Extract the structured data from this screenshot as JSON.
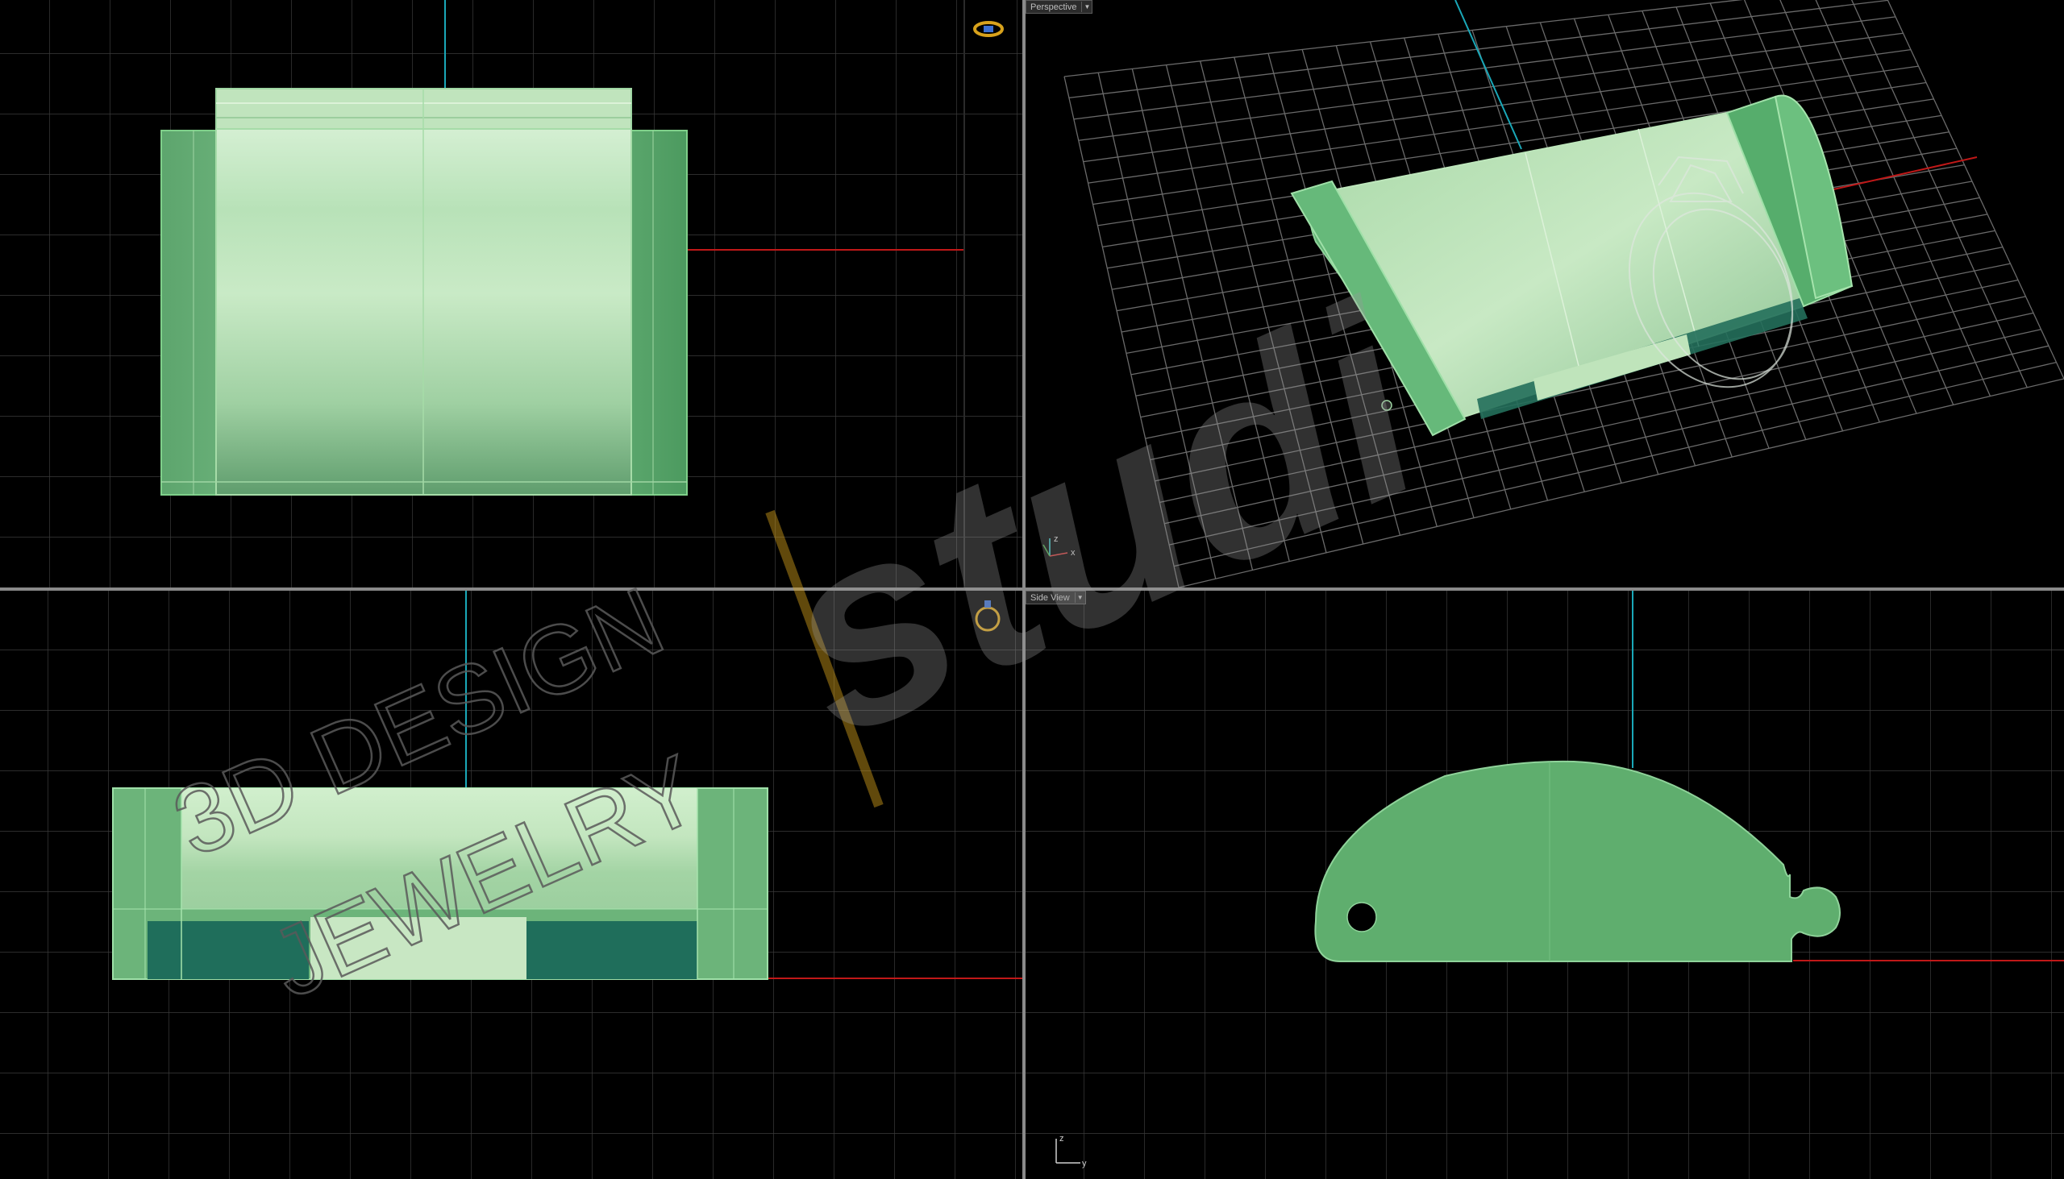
{
  "viewports": {
    "top": {
      "name": ""
    },
    "perspective": {
      "label": "Perspective"
    },
    "front": {
      "name": ""
    },
    "side": {
      "label": "Side View"
    }
  },
  "axis_gizmo": {
    "perspective": {
      "x": "x",
      "z": "z"
    },
    "side": {
      "y": "y",
      "z": "z"
    }
  },
  "watermark": {
    "line1": "3D DESIGN",
    "line2": "JEWELRY",
    "brand": "studi"
  },
  "colors": {
    "background": "#000000",
    "grid": "#3a3a3a",
    "x_axis": "#c01818",
    "y_axis": "#1aa8b8",
    "model_fill": "#7fc98a",
    "model_light": "#cfeccd",
    "model_dark": "#1f6e5b",
    "side_profile": "#5fae6e",
    "accent": "#d8a21c"
  },
  "icons": [
    "ring-icon",
    "ring-icon",
    "dropdown-icon",
    "axis-gizmo-icon"
  ]
}
